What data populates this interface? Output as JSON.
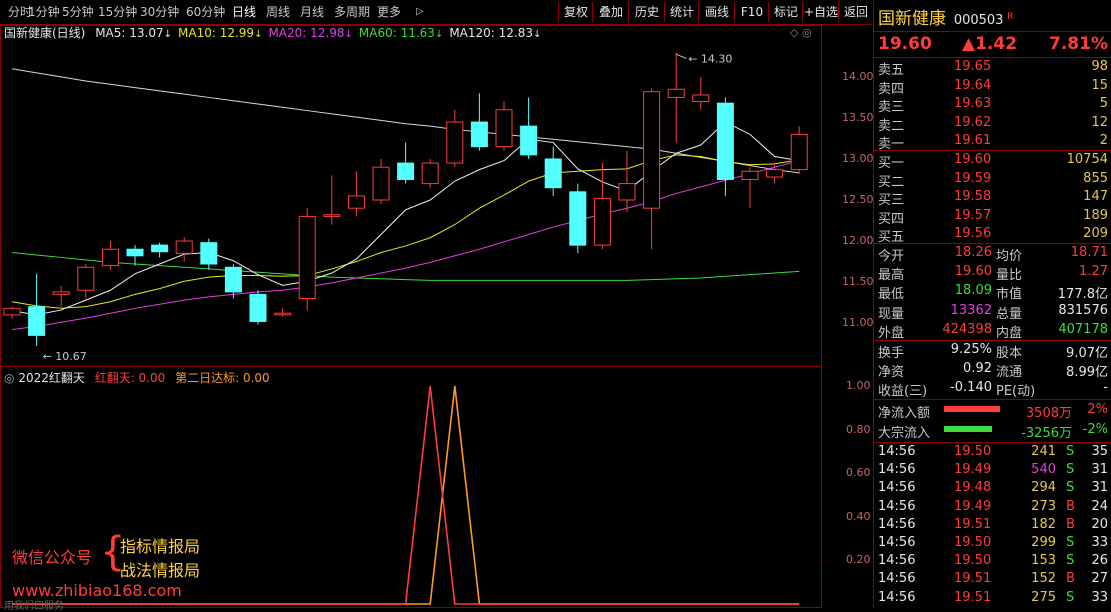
{
  "toolbar": {
    "periods": [
      "分时",
      "1分钟",
      "5分钟",
      "15分钟",
      "30分钟",
      "60分钟",
      "日线",
      "周线",
      "月线",
      "多周期",
      "更多"
    ],
    "active_period": "日线",
    "buttons": [
      "复权",
      "叠加",
      "历史",
      "统计",
      "画线",
      "F10",
      "标记",
      "+自选",
      "返回"
    ]
  },
  "main_chart": {
    "title": "国新健康(日线)",
    "ma_labels": [
      {
        "text": "MA5: 13.07",
        "color": "#e6e6e6"
      },
      {
        "text": "MA10: 12.99",
        "color": "#e6e61e"
      },
      {
        "text": "MA20: 12.98",
        "color": "#e040e0"
      },
      {
        "text": "MA60: 11.63",
        "color": "#3cdc3c"
      },
      {
        "text": "MA120: 12.83",
        "color": "#e6e6e6"
      }
    ],
    "y_ticks": [
      "14.00",
      "13.50",
      "13.00",
      "12.50",
      "12.00",
      "11.50",
      "11.00"
    ],
    "high_note": "14.30",
    "low_note": "10.67",
    "candles": [
      [
        11.1,
        11.18,
        11.2,
        11.05
      ],
      [
        11.2,
        10.85,
        11.6,
        10.72
      ],
      [
        11.35,
        11.38,
        11.45,
        11.2
      ],
      [
        11.4,
        11.68,
        11.72,
        11.3
      ],
      [
        11.7,
        11.9,
        12.0,
        11.65
      ],
      [
        11.9,
        11.82,
        11.95,
        11.7
      ],
      [
        11.95,
        11.87,
        11.98,
        11.8
      ],
      [
        11.85,
        12.0,
        12.05,
        11.75
      ],
      [
        11.98,
        11.72,
        12.03,
        11.65
      ],
      [
        11.68,
        11.38,
        11.72,
        11.3
      ],
      [
        11.35,
        11.02,
        11.4,
        10.98
      ],
      [
        11.1,
        11.12,
        11.18,
        11.08
      ],
      [
        11.3,
        12.3,
        12.4,
        11.15
      ],
      [
        12.3,
        12.32,
        12.8,
        12.2
      ],
      [
        12.4,
        12.55,
        12.85,
        12.3
      ],
      [
        12.5,
        12.9,
        13.0,
        12.45
      ],
      [
        12.95,
        12.75,
        13.2,
        12.7
      ],
      [
        12.7,
        12.95,
        13.0,
        12.65
      ],
      [
        12.95,
        13.45,
        13.6,
        12.9
      ],
      [
        13.45,
        13.15,
        13.8,
        13.1
      ],
      [
        13.15,
        13.6,
        13.7,
        13.1
      ],
      [
        13.4,
        13.05,
        13.75,
        13.0
      ],
      [
        13.0,
        12.65,
        13.15,
        12.55
      ],
      [
        12.6,
        11.95,
        12.7,
        11.85
      ],
      [
        11.95,
        12.52,
        12.95,
        11.9
      ],
      [
        12.5,
        12.7,
        13.1,
        12.35
      ],
      [
        12.4,
        13.82,
        13.86,
        11.9
      ],
      [
        13.75,
        13.85,
        14.3,
        13.2
      ],
      [
        13.7,
        13.78,
        14.0,
        13.6
      ],
      [
        13.68,
        12.75,
        13.75,
        12.55
      ],
      [
        12.75,
        12.85,
        12.9,
        12.4
      ],
      [
        12.78,
        12.87,
        12.95,
        12.7
      ],
      [
        12.87,
        13.3,
        13.4,
        12.82
      ]
    ],
    "ma5": [
      11.15,
      11.1,
      11.16,
      11.28,
      11.4,
      11.6,
      11.72,
      11.84,
      11.86,
      11.76,
      11.59,
      11.46,
      11.51,
      11.61,
      11.78,
      12.08,
      12.38,
      12.5,
      12.73,
      12.87,
      12.98,
      13.24,
      13.2,
      12.88,
      12.72,
      12.61,
      12.85,
      13.07,
      13.17,
      13.45,
      13.3,
      13.03,
      12.98
    ],
    "ma10": [
      11.26,
      11.21,
      11.18,
      11.2,
      11.26,
      11.35,
      11.42,
      11.51,
      11.56,
      11.58,
      11.58,
      11.57,
      11.58,
      11.66,
      11.75,
      11.86,
      11.94,
      12.04,
      12.2,
      12.4,
      12.56,
      12.73,
      12.83,
      12.85,
      12.87,
      12.88,
      12.98,
      13.05,
      13.03,
      12.97,
      12.93,
      12.94,
      12.99
    ],
    "ma20": [
      10.92,
      10.96,
      11.01,
      11.06,
      11.12,
      11.18,
      11.23,
      11.28,
      11.32,
      11.35,
      11.38,
      11.4,
      11.44,
      11.49,
      11.55,
      11.61,
      11.67,
      11.74,
      11.82,
      11.9,
      11.99,
      12.08,
      12.17,
      12.25,
      12.33,
      12.4,
      12.48,
      12.58,
      12.66,
      12.74,
      12.82,
      12.9,
      12.98
    ],
    "ma60": [
      11.86,
      11.83,
      11.8,
      11.77,
      11.74,
      11.72,
      11.7,
      11.68,
      11.66,
      11.64,
      11.62,
      11.6,
      11.58,
      11.56,
      11.55,
      11.54,
      11.53,
      11.52,
      11.52,
      11.52,
      11.52,
      11.52,
      11.52,
      11.52,
      11.52,
      11.52,
      11.53,
      11.54,
      11.55,
      11.57,
      11.59,
      11.61,
      11.63
    ],
    "ma120": [
      14.1,
      14.05,
      14.0,
      13.95,
      13.91,
      13.87,
      13.83,
      13.79,
      13.75,
      13.71,
      13.67,
      13.63,
      13.59,
      13.55,
      13.51,
      13.47,
      13.43,
      13.4,
      13.36,
      13.33,
      13.3,
      13.27,
      13.24,
      13.21,
      13.18,
      13.15,
      13.12,
      13.07,
      13.02,
      12.97,
      12.92,
      12.87,
      12.83
    ]
  },
  "indicator": {
    "name": "2022红翻天",
    "line1_label": "红翻天: 0.00",
    "line2_label": "第二日达标: 0.00",
    "y_ticks": [
      "1.00",
      "0.80",
      "0.60",
      "0.40",
      "0.20"
    ],
    "line1_values": [
      0,
      0,
      0,
      0,
      0,
      0,
      0,
      0,
      0,
      0,
      0,
      0,
      0,
      0,
      0,
      0,
      0,
      1,
      0,
      0,
      0,
      0,
      0,
      0,
      0,
      0,
      0,
      0,
      0,
      0,
      0,
      0,
      0
    ],
    "line2_values": [
      0,
      0,
      0,
      0,
      0,
      0,
      0,
      0,
      0,
      0,
      0,
      0,
      0,
      0,
      0,
      0,
      0,
      0,
      1,
      0,
      0,
      0,
      0,
      0,
      0,
      0,
      0,
      0,
      0,
      0,
      0,
      0,
      0
    ],
    "watermark": {
      "left": "微信公众号",
      "right_top": "指标情报局",
      "right_bottom": "战法情报局",
      "url": "www.zhibiao168.com",
      "bottom_small": "用我们口服务"
    }
  },
  "quote": {
    "name": "国新健康",
    "code": "000503",
    "badge": "R",
    "price": "19.60",
    "change": "▲1.42",
    "pct": "7.81%",
    "asks": [
      {
        "label": "卖五",
        "price": "19.65",
        "vol": "98"
      },
      {
        "label": "卖四",
        "price": "19.64",
        "vol": "15"
      },
      {
        "label": "卖三",
        "price": "19.63",
        "vol": "5"
      },
      {
        "label": "卖二",
        "price": "19.62",
        "vol": "12"
      },
      {
        "label": "卖一",
        "price": "19.61",
        "vol": "2"
      }
    ],
    "bids": [
      {
        "label": "买一",
        "price": "19.60",
        "vol": "10754"
      },
      {
        "label": "买二",
        "price": "19.59",
        "vol": "855"
      },
      {
        "label": "买三",
        "price": "19.58",
        "vol": "147"
      },
      {
        "label": "买四",
        "price": "19.57",
        "vol": "189"
      },
      {
        "label": "买五",
        "price": "19.56",
        "vol": "209"
      }
    ],
    "stats": [
      {
        "l1": "今开",
        "v1": "18.26",
        "c1": "up",
        "l2": "均价",
        "v2": "18.71",
        "c2": "up"
      },
      {
        "l1": "最高",
        "v1": "19.60",
        "c1": "up",
        "l2": "量比",
        "v2": "1.27",
        "c2": "up"
      },
      {
        "l1": "最低",
        "v1": "18.09",
        "c1": "dn",
        "l2": "市值",
        "v2": "177.8亿",
        "c2": "wh"
      },
      {
        "l1": "现量",
        "v1": "13362",
        "c1": "mg",
        "l2": "总量",
        "v2": "831576",
        "c2": "wh"
      },
      {
        "l1": "外盘",
        "v1": "424398",
        "c1": "up",
        "l2": "内盘",
        "v2": "407178",
        "c2": "dn"
      }
    ],
    "stats2": [
      {
        "l1": "换手",
        "v1": "9.25%",
        "l2": "股本",
        "v2": "9.07亿"
      },
      {
        "l1": "净资",
        "v1": "0.92",
        "l2": "流通",
        "v2": "8.99亿"
      },
      {
        "l1": "收益(三)",
        "v1": "-0.140",
        "l2": "PE(动)",
        "v2": "-"
      }
    ],
    "flows": [
      {
        "label": "净流入额",
        "value": "3508万",
        "pct": "2%",
        "color": "#ff3c3c",
        "bar": 1.0
      },
      {
        "label": "大宗流入",
        "value": "-3256万",
        "pct": "-2%",
        "color": "#3cdc3c",
        "bar": 0.85
      }
    ],
    "ticks": [
      {
        "t": "14:56",
        "p": "19.50",
        "v": "241",
        "vc": "yl",
        "s": "S"
      },
      {
        "t": "14:56",
        "p": "19.49",
        "v": "540",
        "vc": "mg",
        "s": "S"
      },
      {
        "t": "14:56",
        "p": "19.48",
        "v": "294",
        "vc": "yl",
        "s": "S"
      },
      {
        "t": "14:56",
        "p": "19.49",
        "v": "273",
        "vc": "yl",
        "s": "B"
      },
      {
        "t": "14:56",
        "p": "19.51",
        "v": "182",
        "vc": "yl",
        "s": "B"
      },
      {
        "t": "14:56",
        "p": "19.50",
        "v": "299",
        "vc": "yl",
        "s": "S"
      },
      {
        "t": "14:56",
        "p": "19.50",
        "v": "153",
        "vc": "yl",
        "s": "S"
      },
      {
        "t": "14:56",
        "p": "19.51",
        "v": "152",
        "vc": "yl",
        "s": "B"
      },
      {
        "t": "14:56",
        "p": "19.51",
        "v": "275",
        "vc": "yl",
        "s": "S"
      }
    ],
    "tick_counts": [
      "35",
      "31",
      "31",
      "24",
      "20",
      "33",
      "26",
      "27",
      "33"
    ]
  }
}
